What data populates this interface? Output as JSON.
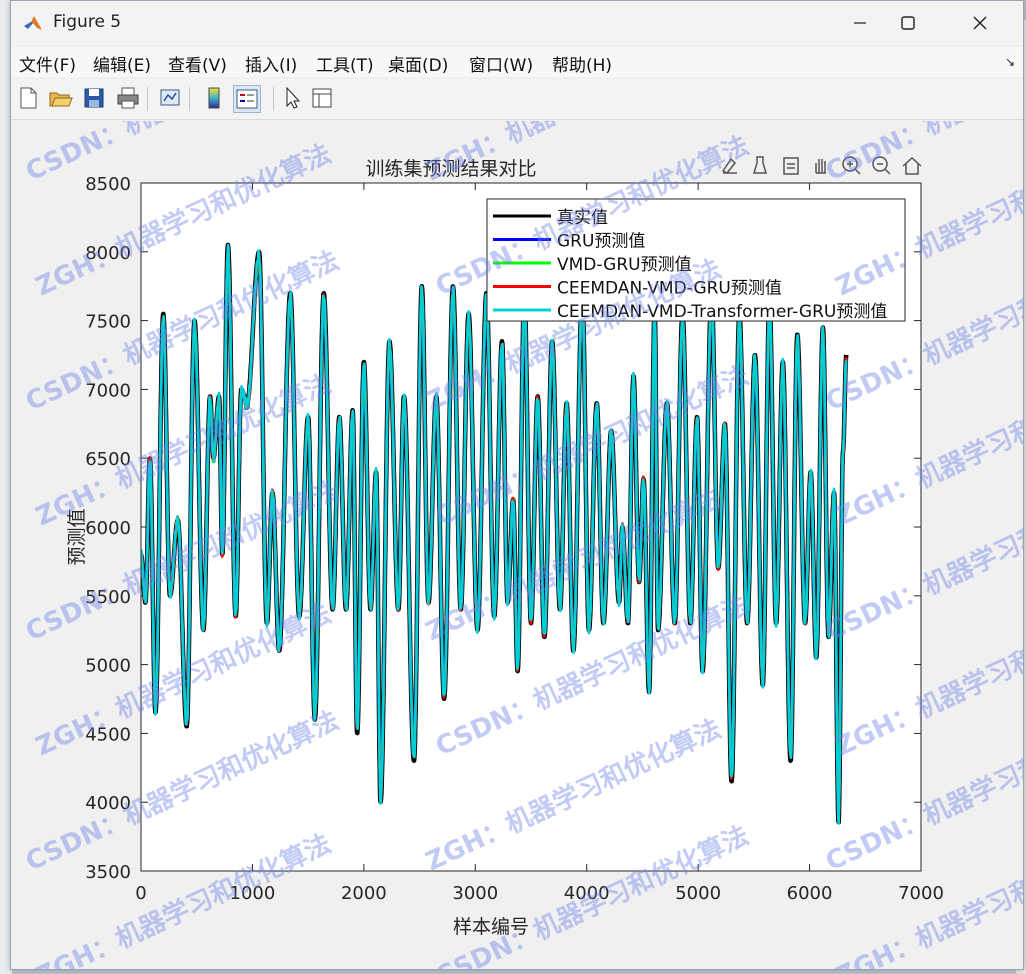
{
  "window": {
    "title": "Figure 5"
  },
  "menu": [
    "文件(F)",
    "编辑(E)",
    "查看(V)",
    "插入(I)",
    "工具(T)",
    "桌面(D)",
    "窗口(W)",
    "帮助(H)"
  ],
  "toolbar_icons": [
    "new-figure-icon",
    "open-file-icon",
    "save-icon",
    "print-icon",
    "link-plot-icon",
    "insert-colorbar-icon",
    "insert-legend-icon",
    "edit-plot-icon",
    "property-inspector-icon"
  ],
  "axes_toolbar_icons": [
    "data-tips-icon",
    "brush-icon",
    "restore-view-icon",
    "pan-icon",
    "zoom-in-icon",
    "zoom-out-icon",
    "home-icon"
  ],
  "watermarks": [
    "ZGH：机器学习和优化算法",
    "CSDN：机器学习和优化算法"
  ],
  "colors": {
    "true": "#000000",
    "gru": "#0000ff",
    "vmd_gru": "#00ff00",
    "ceemdan_vmd_gru": "#ff0000",
    "transformer_gru": "#00cfd6",
    "watermark": "#6f84e6"
  },
  "chart_data": {
    "type": "line",
    "title": "训练集预测结果对比",
    "xlabel": "样本编号",
    "ylabel": "预测值",
    "xlim": [
      0,
      7000
    ],
    "ylim": [
      3500,
      8500
    ],
    "xticks": [
      0,
      1000,
      2000,
      3000,
      4000,
      5000,
      6000,
      7000
    ],
    "yticks": [
      3500,
      4000,
      4500,
      5000,
      5500,
      6000,
      6500,
      7000,
      7500,
      8000,
      8500
    ],
    "legend_position": "top-right",
    "n_points": 6240,
    "peaks_troughs": [
      [
        0,
        5800
      ],
      [
        40,
        5450
      ],
      [
        80,
        6500
      ],
      [
        130,
        4650
      ],
      [
        200,
        7550
      ],
      [
        260,
        5500
      ],
      [
        330,
        6050
      ],
      [
        410,
        4550
      ],
      [
        480,
        7500
      ],
      [
        560,
        5250
      ],
      [
        620,
        6950
      ],
      [
        650,
        6500
      ],
      [
        700,
        6950
      ],
      [
        730,
        5800
      ],
      [
        780,
        8050
      ],
      [
        850,
        5350
      ],
      [
        900,
        7000
      ],
      [
        950,
        6900
      ],
      [
        1060,
        8000
      ],
      [
        1130,
        5300
      ],
      [
        1180,
        6250
      ],
      [
        1240,
        5100
      ],
      [
        1340,
        7700
      ],
      [
        1420,
        5350
      ],
      [
        1500,
        6800
      ],
      [
        1560,
        4600
      ],
      [
        1640,
        7700
      ],
      [
        1720,
        5400
      ],
      [
        1780,
        6800
      ],
      [
        1840,
        5400
      ],
      [
        1900,
        6850
      ],
      [
        1940,
        4500
      ],
      [
        2000,
        7200
      ],
      [
        2060,
        5400
      ],
      [
        2110,
        6400
      ],
      [
        2150,
        4000
      ],
      [
        2230,
        7350
      ],
      [
        2310,
        5400
      ],
      [
        2360,
        6950
      ],
      [
        2450,
        4300
      ],
      [
        2520,
        7750
      ],
      [
        2580,
        5450
      ],
      [
        2650,
        6950
      ],
      [
        2720,
        4750
      ],
      [
        2800,
        7750
      ],
      [
        2870,
        5400
      ],
      [
        2940,
        7550
      ],
      [
        3020,
        5250
      ],
      [
        3100,
        7700
      ],
      [
        3170,
        5350
      ],
      [
        3240,
        7350
      ],
      [
        3290,
        5450
      ],
      [
        3340,
        6200
      ],
      [
        3380,
        4950
      ],
      [
        3440,
        7700
      ],
      [
        3500,
        5300
      ],
      [
        3560,
        6950
      ],
      [
        3620,
        5200
      ],
      [
        3690,
        7350
      ],
      [
        3760,
        5400
      ],
      [
        3820,
        6900
      ],
      [
        3880,
        5100
      ],
      [
        3960,
        7700
      ],
      [
        4020,
        5250
      ],
      [
        4090,
        6900
      ],
      [
        4150,
        5300
      ],
      [
        4220,
        6700
      ],
      [
        4290,
        5450
      ],
      [
        4320,
        6000
      ],
      [
        4370,
        5300
      ],
      [
        4420,
        7100
      ],
      [
        4470,
        5600
      ],
      [
        4510,
        6350
      ],
      [
        4560,
        4800
      ],
      [
        4610,
        7600
      ],
      [
        4640,
        5250
      ],
      [
        4720,
        6900
      ],
      [
        4790,
        5300
      ],
      [
        4860,
        7550
      ],
      [
        4930,
        5300
      ],
      [
        4990,
        6800
      ],
      [
        5040,
        4950
      ],
      [
        5120,
        7700
      ],
      [
        5180,
        5700
      ],
      [
        5240,
        6750
      ],
      [
        5300,
        4150
      ],
      [
        5370,
        7550
      ],
      [
        5440,
        5300
      ],
      [
        5510,
        7250
      ],
      [
        5580,
        4850
      ],
      [
        5640,
        7650
      ],
      [
        5700,
        5300
      ],
      [
        5760,
        7200
      ],
      [
        5830,
        4300
      ],
      [
        5890,
        7400
      ],
      [
        5960,
        5300
      ],
      [
        6010,
        6400
      ],
      [
        6060,
        5050
      ],
      [
        6120,
        7450
      ],
      [
        6170,
        5200
      ],
      [
        6220,
        6250
      ],
      [
        6260,
        3850
      ],
      [
        6300,
        6550
      ],
      [
        6330,
        7250
      ]
    ],
    "series": [
      {
        "name": "真实值"
      },
      {
        "name": "GRU预测值"
      },
      {
        "name": "VMD-GRU预测值"
      },
      {
        "name": "CEEMDAN-VMD-GRU预测值"
      },
      {
        "name": "CEEMDAN-VMD-Transformer-GRU预测值"
      }
    ]
  }
}
